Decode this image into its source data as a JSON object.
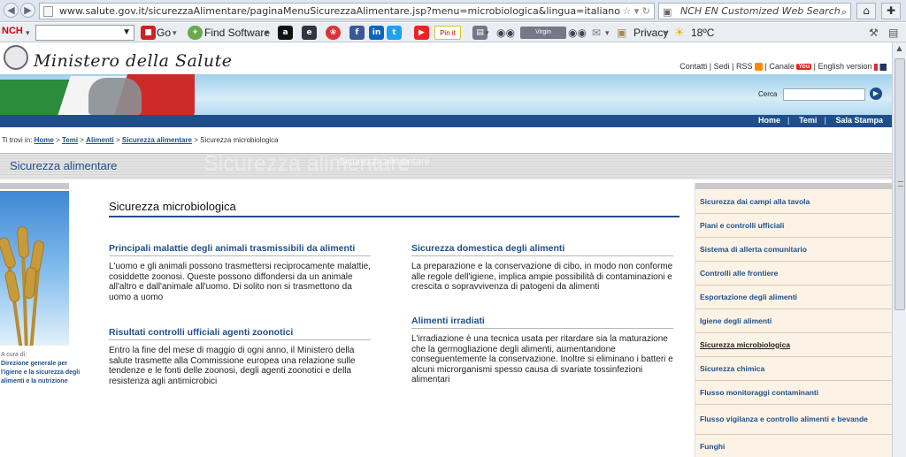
{
  "browser": {
    "url": "www.salute.gov.it/sicurezzaAlimentare/paginaMenuSicurezzaAlimentare.jsp?menu=microbiologica&lingua=italiano",
    "search_placeholder": "NCH EN Customized Web Search",
    "toolbar": {
      "logo": "NCH",
      "go": "Go",
      "find_software": "Find Software",
      "pinit": "Pin it",
      "media": "Virgin",
      "privacy": "Privacy",
      "weather": "18ºC"
    }
  },
  "site": {
    "logo": "Ministero della Salute",
    "header_links": [
      "Contatti",
      "Sedi",
      "RSS",
      "Canale",
      "English version"
    ],
    "search_label": "Cerca",
    "nav": [
      "Home",
      "Temi",
      "Sala Stampa"
    ],
    "breadcrumb": {
      "prefix": "Ti trovi in:",
      "links": [
        "Home",
        "Temi",
        "Alimenti",
        "Sicurezza alimentare"
      ],
      "current": "Sicurezza microbiologica"
    },
    "section_title": "Sicurezza alimentare",
    "section_ghost": "Sicurezza alimentare",
    "left": {
      "acura": "A cura di:",
      "direzione": "Direzione generale per l'igiene e la sicurezza degli alimenti e la nutrizione"
    },
    "main": {
      "title": "Sicurezza microbiologica",
      "articles": [
        {
          "title": "Principali malattie degli animali trasmissibili da alimenti",
          "body": "L'uomo e gli animali possono trasmettersi reciprocamente malattie, cosiddette zoonosi. Queste possono diffondersi da un animale all'altro e dall'animale all'uomo. Di solito non si trasmettono da uomo a uomo"
        },
        {
          "title": "Risultati controlli ufficiali agenti zoonotici",
          "body": "Entro la fine del mese di maggio di ogni anno, il Ministero della salute trasmette alla Commissione europea una relazione sulle tendenze e le fonti delle zoonosi, degli agenti zoonotici e della resistenza agli antimicrobici"
        },
        {
          "title": "Sicurezza domestica degli alimenti",
          "body": "La preparazione e la conservazione di cibo, in modo non conforme alle regole dell'igiene, implica ampie possibilità di contaminazioni e crescita o sopravvivenza di patogeni da alimenti"
        },
        {
          "title": "Alimenti irradiati",
          "body": "L'irradiazione è una tecnica usata per ritardare sia la maturazione che la germogliazione degli alimenti, aumentandone conseguentemente la conservazione. Inoltre si eliminano i batteri e alcuni microrganismi spesso causa di svariate tossinfezioni alimentari"
        }
      ]
    },
    "sidebar": [
      "Sicurezza dai campi alla tavola",
      "Piani e controlli ufficiali",
      "Sistema di allerta comunitario",
      "Controlli alle frontiere",
      "Esportazione degli alimenti",
      "Igiene degli alimenti",
      "Sicurezza microbiologica",
      "Sicurezza chimica",
      "Flusso monitoraggi contaminanti",
      "Flusso vigilanza e controllo alimenti e bevande",
      "Funghi"
    ],
    "sidebar_active": "Sicurezza microbiologica"
  }
}
